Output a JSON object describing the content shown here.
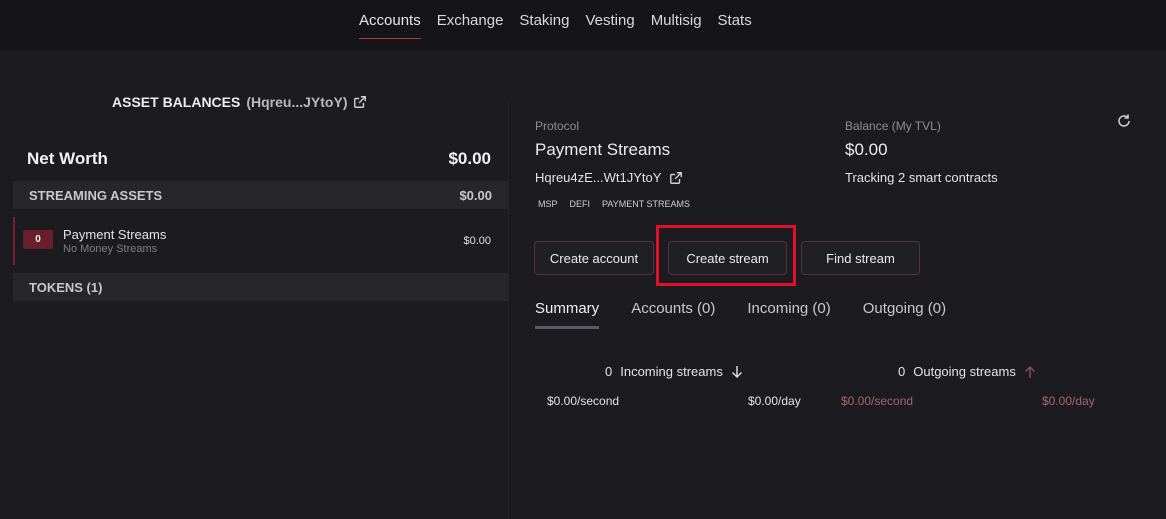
{
  "nav": [
    "Accounts",
    "Exchange",
    "Staking",
    "Vesting",
    "Multisig",
    "Stats"
  ],
  "left": {
    "title": "ASSET BALANCES",
    "address": "(Hqreu...JYtoY)",
    "net_worth_label": "Net Worth",
    "net_worth_value": "$0.00",
    "streaming_label": "STREAMING ASSETS",
    "streaming_value": "$0.00",
    "stream": {
      "count": "0",
      "name": "Payment Streams",
      "sub": "No Money Streams",
      "value": "$0.00"
    },
    "tokens_label": "TOKENS (1)"
  },
  "right": {
    "protocol_label": "Protocol",
    "protocol_value": "Payment Streams",
    "contract": "Hqreu4zE...Wt1JYtoY",
    "balance_label": "Balance (My TVL)",
    "balance_value": "$0.00",
    "tracking": "Tracking 2 smart contracts",
    "tags": [
      "MSP",
      "DEFI",
      "PAYMENT STREAMS"
    ],
    "buttons": {
      "create_account": "Create account",
      "create_stream": "Create stream",
      "find_stream": "Find stream"
    },
    "tabs": [
      "Summary",
      "Accounts (0)",
      "Incoming (0)",
      "Outgoing (0)"
    ],
    "incoming": {
      "count": "0",
      "label": "Incoming streams",
      "per_second": "$0.00/second",
      "per_day": "$0.00/day"
    },
    "outgoing": {
      "count": "0",
      "label": "Outgoing streams",
      "per_second": "$0.00/second",
      "per_day": "$0.00/day"
    }
  },
  "colors": {
    "accent": "#b0354a",
    "highlight": "#e0102a",
    "outgoing_text": "#a2656f",
    "button_border": "#54343b"
  }
}
